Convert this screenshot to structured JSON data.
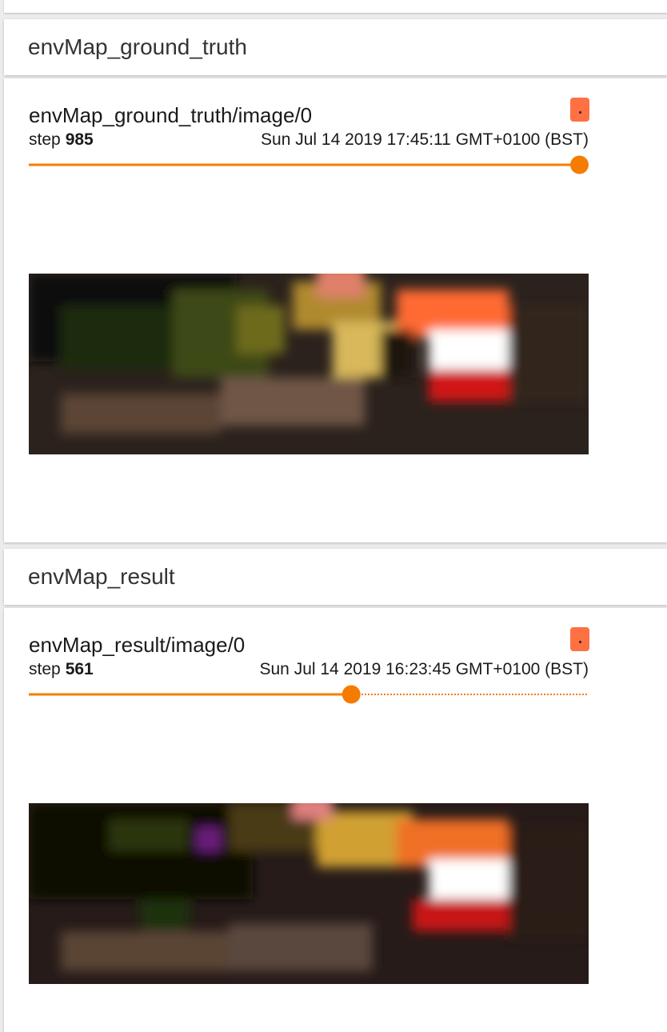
{
  "sections": [
    {
      "header": "envMap_ground_truth",
      "card": {
        "title": "envMap_ground_truth/image/0",
        "step_label": "step",
        "step": "985",
        "timestamp": "Sun Jul 14 2019 17:45:11 GMT+0100 (BST)",
        "slider_fraction": 1.0,
        "image_icon": "pixelated-environment-map"
      }
    },
    {
      "header": "envMap_result",
      "card": {
        "title": "envMap_result/image/0",
        "step_label": "step",
        "step": "561",
        "timestamp": "Sun Jul 14 2019 16:23:45 GMT+0100 (BST)",
        "slider_fraction": 0.576,
        "image_icon": "pixelated-environment-map"
      }
    }
  ],
  "colors": {
    "accent": "#f57c00",
    "menu_button": "#ff7043",
    "background": "#ececec",
    "card": "#ffffff"
  }
}
